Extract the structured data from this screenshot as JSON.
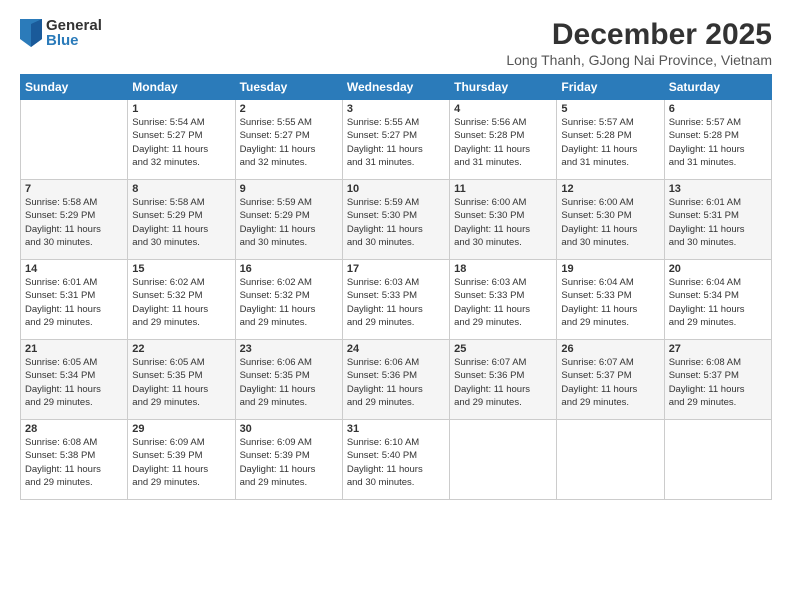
{
  "logo": {
    "general": "General",
    "blue": "Blue"
  },
  "title": "December 2025",
  "location": "Long Thanh, GJong Nai Province, Vietnam",
  "days_of_week": [
    "Sunday",
    "Monday",
    "Tuesday",
    "Wednesday",
    "Thursday",
    "Friday",
    "Saturday"
  ],
  "weeks": [
    [
      {
        "day": "",
        "content": ""
      },
      {
        "day": "1",
        "content": "Sunrise: 5:54 AM\nSunset: 5:27 PM\nDaylight: 11 hours\nand 32 minutes."
      },
      {
        "day": "2",
        "content": "Sunrise: 5:55 AM\nSunset: 5:27 PM\nDaylight: 11 hours\nand 32 minutes."
      },
      {
        "day": "3",
        "content": "Sunrise: 5:55 AM\nSunset: 5:27 PM\nDaylight: 11 hours\nand 31 minutes."
      },
      {
        "day": "4",
        "content": "Sunrise: 5:56 AM\nSunset: 5:28 PM\nDaylight: 11 hours\nand 31 minutes."
      },
      {
        "day": "5",
        "content": "Sunrise: 5:57 AM\nSunset: 5:28 PM\nDaylight: 11 hours\nand 31 minutes."
      },
      {
        "day": "6",
        "content": "Sunrise: 5:57 AM\nSunset: 5:28 PM\nDaylight: 11 hours\nand 31 minutes."
      }
    ],
    [
      {
        "day": "7",
        "content": "Sunrise: 5:58 AM\nSunset: 5:29 PM\nDaylight: 11 hours\nand 30 minutes."
      },
      {
        "day": "8",
        "content": "Sunrise: 5:58 AM\nSunset: 5:29 PM\nDaylight: 11 hours\nand 30 minutes."
      },
      {
        "day": "9",
        "content": "Sunrise: 5:59 AM\nSunset: 5:29 PM\nDaylight: 11 hours\nand 30 minutes."
      },
      {
        "day": "10",
        "content": "Sunrise: 5:59 AM\nSunset: 5:30 PM\nDaylight: 11 hours\nand 30 minutes."
      },
      {
        "day": "11",
        "content": "Sunrise: 6:00 AM\nSunset: 5:30 PM\nDaylight: 11 hours\nand 30 minutes."
      },
      {
        "day": "12",
        "content": "Sunrise: 6:00 AM\nSunset: 5:30 PM\nDaylight: 11 hours\nand 30 minutes."
      },
      {
        "day": "13",
        "content": "Sunrise: 6:01 AM\nSunset: 5:31 PM\nDaylight: 11 hours\nand 30 minutes."
      }
    ],
    [
      {
        "day": "14",
        "content": "Sunrise: 6:01 AM\nSunset: 5:31 PM\nDaylight: 11 hours\nand 29 minutes."
      },
      {
        "day": "15",
        "content": "Sunrise: 6:02 AM\nSunset: 5:32 PM\nDaylight: 11 hours\nand 29 minutes."
      },
      {
        "day": "16",
        "content": "Sunrise: 6:02 AM\nSunset: 5:32 PM\nDaylight: 11 hours\nand 29 minutes."
      },
      {
        "day": "17",
        "content": "Sunrise: 6:03 AM\nSunset: 5:33 PM\nDaylight: 11 hours\nand 29 minutes."
      },
      {
        "day": "18",
        "content": "Sunrise: 6:03 AM\nSunset: 5:33 PM\nDaylight: 11 hours\nand 29 minutes."
      },
      {
        "day": "19",
        "content": "Sunrise: 6:04 AM\nSunset: 5:33 PM\nDaylight: 11 hours\nand 29 minutes."
      },
      {
        "day": "20",
        "content": "Sunrise: 6:04 AM\nSunset: 5:34 PM\nDaylight: 11 hours\nand 29 minutes."
      }
    ],
    [
      {
        "day": "21",
        "content": "Sunrise: 6:05 AM\nSunset: 5:34 PM\nDaylight: 11 hours\nand 29 minutes."
      },
      {
        "day": "22",
        "content": "Sunrise: 6:05 AM\nSunset: 5:35 PM\nDaylight: 11 hours\nand 29 minutes."
      },
      {
        "day": "23",
        "content": "Sunrise: 6:06 AM\nSunset: 5:35 PM\nDaylight: 11 hours\nand 29 minutes."
      },
      {
        "day": "24",
        "content": "Sunrise: 6:06 AM\nSunset: 5:36 PM\nDaylight: 11 hours\nand 29 minutes."
      },
      {
        "day": "25",
        "content": "Sunrise: 6:07 AM\nSunset: 5:36 PM\nDaylight: 11 hours\nand 29 minutes."
      },
      {
        "day": "26",
        "content": "Sunrise: 6:07 AM\nSunset: 5:37 PM\nDaylight: 11 hours\nand 29 minutes."
      },
      {
        "day": "27",
        "content": "Sunrise: 6:08 AM\nSunset: 5:37 PM\nDaylight: 11 hours\nand 29 minutes."
      }
    ],
    [
      {
        "day": "28",
        "content": "Sunrise: 6:08 AM\nSunset: 5:38 PM\nDaylight: 11 hours\nand 29 minutes."
      },
      {
        "day": "29",
        "content": "Sunrise: 6:09 AM\nSunset: 5:39 PM\nDaylight: 11 hours\nand 29 minutes."
      },
      {
        "day": "30",
        "content": "Sunrise: 6:09 AM\nSunset: 5:39 PM\nDaylight: 11 hours\nand 29 minutes."
      },
      {
        "day": "31",
        "content": "Sunrise: 6:10 AM\nSunset: 5:40 PM\nDaylight: 11 hours\nand 30 minutes."
      },
      {
        "day": "",
        "content": ""
      },
      {
        "day": "",
        "content": ""
      },
      {
        "day": "",
        "content": ""
      }
    ]
  ]
}
